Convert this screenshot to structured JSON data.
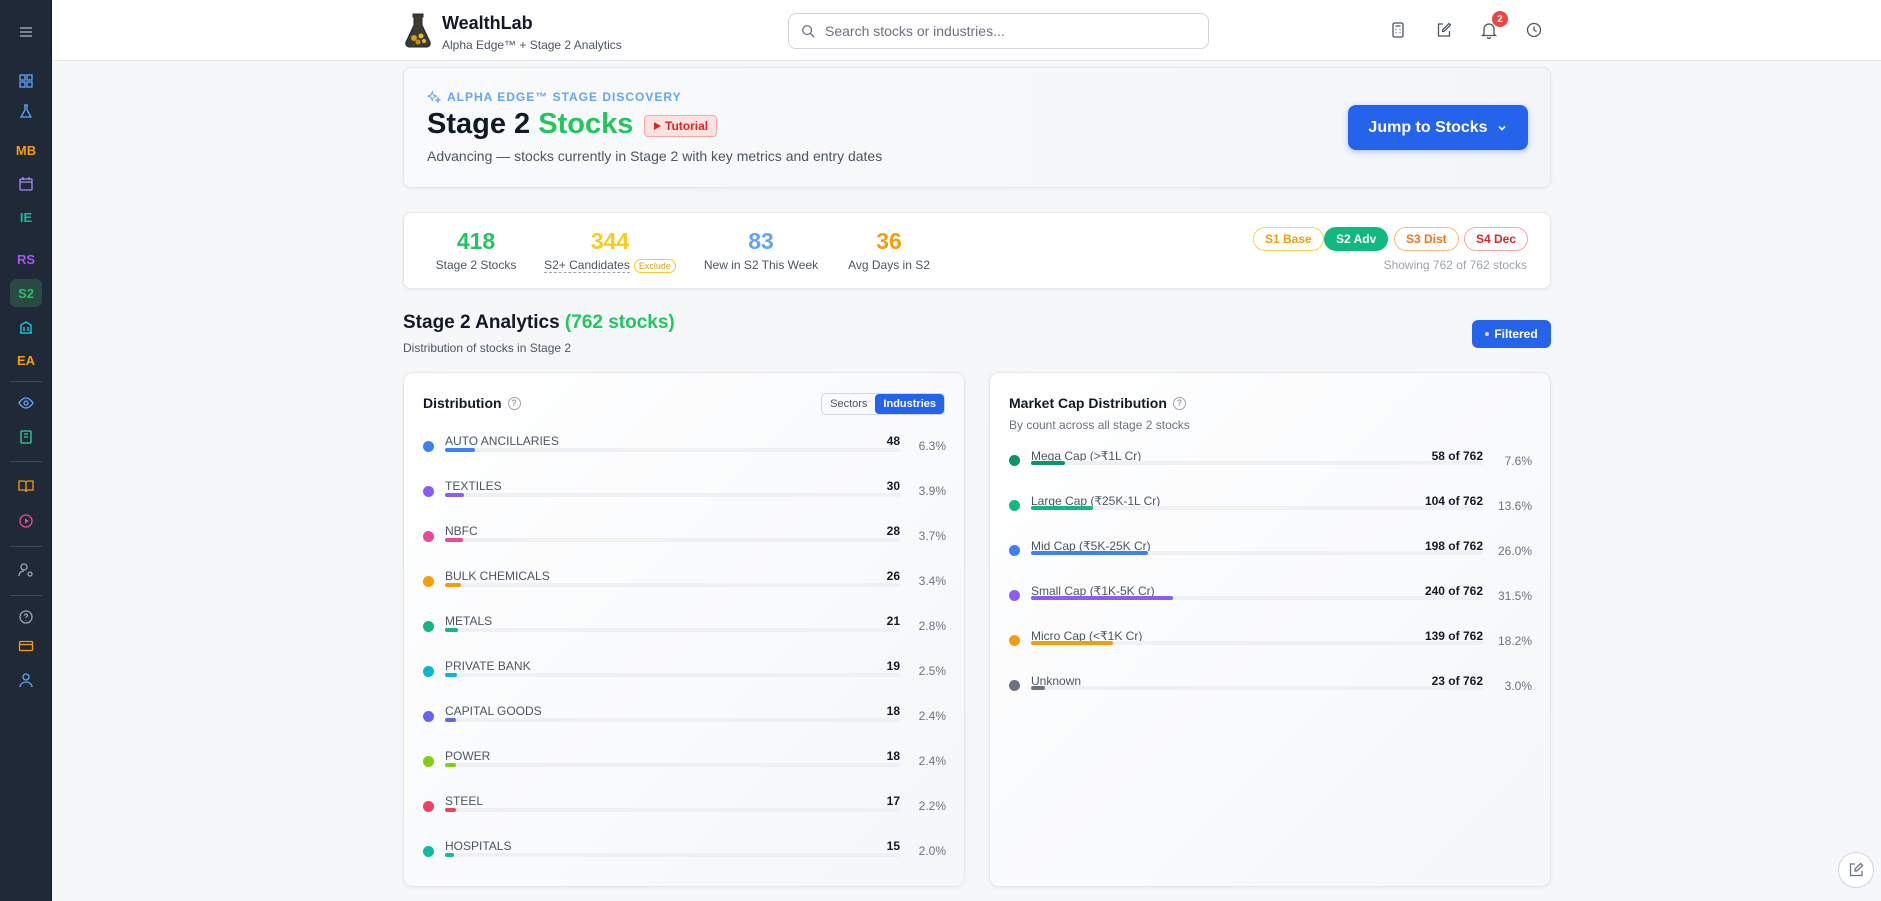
{
  "app": {
    "title": "WealthLab",
    "subtitle": "Alpha Edge™ + Stage 2 Analytics",
    "notification_count": "2"
  },
  "sidebar": {
    "items": [
      {
        "name": "menu-icon",
        "type": "icon"
      },
      {
        "name": "dashboard-icon",
        "type": "icon"
      },
      {
        "name": "flask-icon",
        "type": "icon"
      },
      {
        "name": "sidebar-item-mb",
        "type": "text",
        "label": "MB",
        "color": "#f59e0b"
      },
      {
        "name": "calendar-icon",
        "type": "icon"
      },
      {
        "name": "sidebar-item-ie",
        "type": "text",
        "label": "IE",
        "color": "#14b8a6"
      },
      {
        "name": "sidebar-item-rs",
        "type": "text",
        "label": "RS",
        "color": "#a855f7"
      },
      {
        "name": "sidebar-item-s2",
        "type": "text",
        "label": "S2",
        "color": "#22c55e"
      },
      {
        "name": "building-icon",
        "type": "icon"
      },
      {
        "name": "sidebar-item-ea",
        "type": "text",
        "label": "EA",
        "color": "#f59e0b"
      },
      {
        "name": "eye-icon",
        "type": "icon"
      },
      {
        "name": "notebook-icon",
        "type": "icon"
      },
      {
        "name": "book-icon",
        "type": "icon"
      },
      {
        "name": "play-circle-icon",
        "type": "icon"
      },
      {
        "name": "user-settings-icon",
        "type": "icon"
      },
      {
        "name": "help-icon",
        "type": "icon"
      },
      {
        "name": "card-icon",
        "type": "icon"
      },
      {
        "name": "user-icon",
        "type": "icon"
      }
    ]
  },
  "search": {
    "placeholder": "Search stocks or industries..."
  },
  "hero": {
    "eyebrow": "ALPHA EDGE™ STAGE DISCOVERY",
    "title_main": "Stage 2",
    "title_accent": "Stocks",
    "tutorial_label": "Tutorial",
    "subtitle": "Advancing — stocks currently in Stage 2 with key metrics and entry dates",
    "jump_label": "Jump to Stocks"
  },
  "stats": {
    "items": [
      {
        "value": "418",
        "label": "Stage 2 Stocks",
        "color": "#22c55e"
      },
      {
        "value": "344",
        "label": "S2+ Candidates",
        "color": "#facc15",
        "tag": "Exclude"
      },
      {
        "value": "83",
        "label": "New in S2 This Week",
        "color": "#60a5fa"
      },
      {
        "value": "36",
        "label": "Avg Days in S2",
        "color": "#f59e0b"
      }
    ],
    "stages": [
      {
        "label": "S1 Base",
        "active": false,
        "color": "#f59e0b"
      },
      {
        "label": "S2 Adv",
        "active": true,
        "color": "#10b981"
      },
      {
        "label": "S3 Dist",
        "active": false,
        "color": "#f97316"
      },
      {
        "label": "S4 Dec",
        "active": false,
        "color": "#dc2626"
      }
    ],
    "showing": "Showing 762 of 762 stocks"
  },
  "analytics": {
    "title": "Stage 2 Analytics",
    "count_label": "(762 stocks)",
    "subtitle": "Distribution of stocks in Stage 2",
    "filter_label": "Filtered"
  },
  "distribution": {
    "title": "Distribution",
    "tabs": [
      "Sectors",
      "Industries"
    ],
    "active_tab": "Industries",
    "max": 48,
    "rows": [
      {
        "label": "AUTO ANCILLARIES",
        "count": 48,
        "pct": "6.3%",
        "color": "#3b82f6"
      },
      {
        "label": "TEXTILES",
        "count": 30,
        "pct": "3.9%",
        "color": "#8b5cf6"
      },
      {
        "label": "NBFC",
        "count": 28,
        "pct": "3.7%",
        "color": "#ec4899"
      },
      {
        "label": "BULK CHEMICALS",
        "count": 26,
        "pct": "3.4%",
        "color": "#f59e0b"
      },
      {
        "label": "METALS",
        "count": 21,
        "pct": "2.8%",
        "color": "#10b981"
      },
      {
        "label": "PRIVATE BANK",
        "count": 19,
        "pct": "2.5%",
        "color": "#06b6d4"
      },
      {
        "label": "CAPITAL GOODS",
        "count": 18,
        "pct": "2.4%",
        "color": "#6366f1"
      },
      {
        "label": "POWER",
        "count": 18,
        "pct": "2.4%",
        "color": "#84cc16"
      },
      {
        "label": "STEEL",
        "count": 17,
        "pct": "2.2%",
        "color": "#f43f5e"
      },
      {
        "label": "HOSPITALS",
        "count": 15,
        "pct": "2.0%",
        "color": "#14b8a6"
      }
    ]
  },
  "market_cap": {
    "title": "Market Cap Distribution",
    "subtitle": "By count across all stage 2 stocks",
    "total": 762,
    "rows": [
      {
        "label": "Mega Cap (>₹1L Cr)",
        "count": 58,
        "count_text": "58 of 762",
        "pct": "7.6%",
        "color": "#059669"
      },
      {
        "label": "Large Cap (₹25K-1L Cr)",
        "count": 104,
        "count_text": "104 of 762",
        "pct": "13.6%",
        "color": "#10b981"
      },
      {
        "label": "Mid Cap (₹5K-25K Cr)",
        "count": 198,
        "count_text": "198 of 762",
        "pct": "26.0%",
        "color": "#3b82f6"
      },
      {
        "label": "Small Cap (₹1K-5K Cr)",
        "count": 240,
        "count_text": "240 of 762",
        "pct": "31.5%",
        "color": "#8b5cf6"
      },
      {
        "label": "Micro Cap (<₹1K Cr)",
        "count": 139,
        "count_text": "139 of 762",
        "pct": "18.2%",
        "color": "#f59e0b"
      },
      {
        "label": "Unknown",
        "count": 23,
        "count_text": "23 of 762",
        "pct": "3.0%",
        "color": "#6b7280"
      }
    ]
  }
}
